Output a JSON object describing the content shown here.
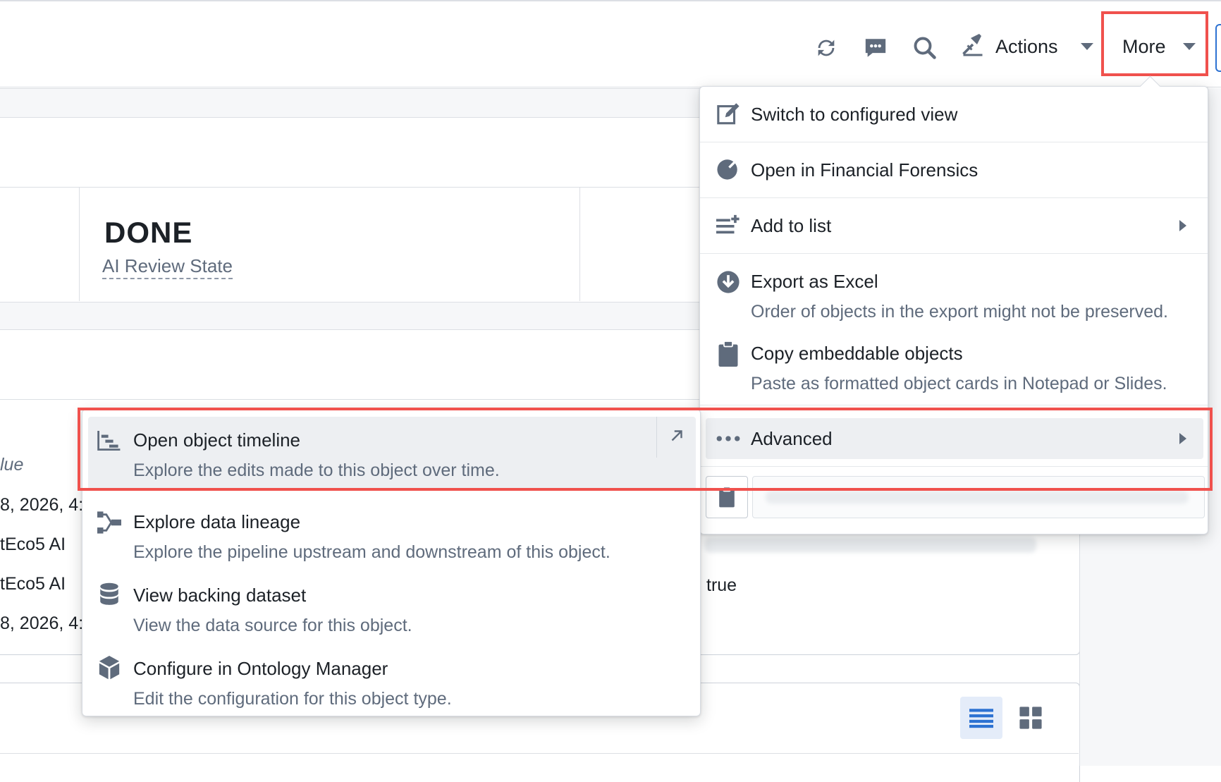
{
  "toolbar": {
    "actions_label": "Actions",
    "more_label": "More",
    "icons": [
      "refresh-icon",
      "comment-icon",
      "search-icon",
      "actions-icon"
    ]
  },
  "background": {
    "status_value": "DONE",
    "status_label": "AI Review State",
    "partial_header": "lue",
    "rows": [
      "8, 2026, 4:",
      "tEco5 AI",
      "tEco5 AI",
      "8, 2026, 4:"
    ],
    "true_value": "true"
  },
  "more_menu": {
    "items": [
      {
        "icon": "edit-icon",
        "label": "Switch to configured view"
      },
      {
        "icon": "chart-icon",
        "label": "Open in Financial Forensics"
      },
      {
        "icon": "add-to-list-icon",
        "label": "Add to list"
      },
      {
        "icon": "download-icon",
        "label": "Export as Excel",
        "sub": "Order of objects in the export might not be preserved."
      },
      {
        "icon": "clipboard-icon",
        "label": "Copy embeddable objects",
        "sub": "Paste as formatted object cards in Notepad or Slides."
      },
      {
        "icon": "more-icon",
        "label": "Advanced"
      }
    ]
  },
  "advanced_menu": {
    "items": [
      {
        "icon": "timeline-icon",
        "label": "Open object timeline",
        "sub": "Explore the edits made to this object over time."
      },
      {
        "icon": "lineage-icon",
        "label": "Explore data lineage",
        "sub": "Explore the pipeline upstream and downstream of this object."
      },
      {
        "icon": "database-icon",
        "label": "View backing dataset",
        "sub": "View the data source for this object."
      },
      {
        "icon": "cube-icon",
        "label": "Configure in Ontology Manager",
        "sub": "Edit the configuration for this object type."
      }
    ]
  },
  "colors": {
    "highlight": "#f0514d",
    "icon": "#5f6b7c",
    "accent": "#2d72d2"
  }
}
